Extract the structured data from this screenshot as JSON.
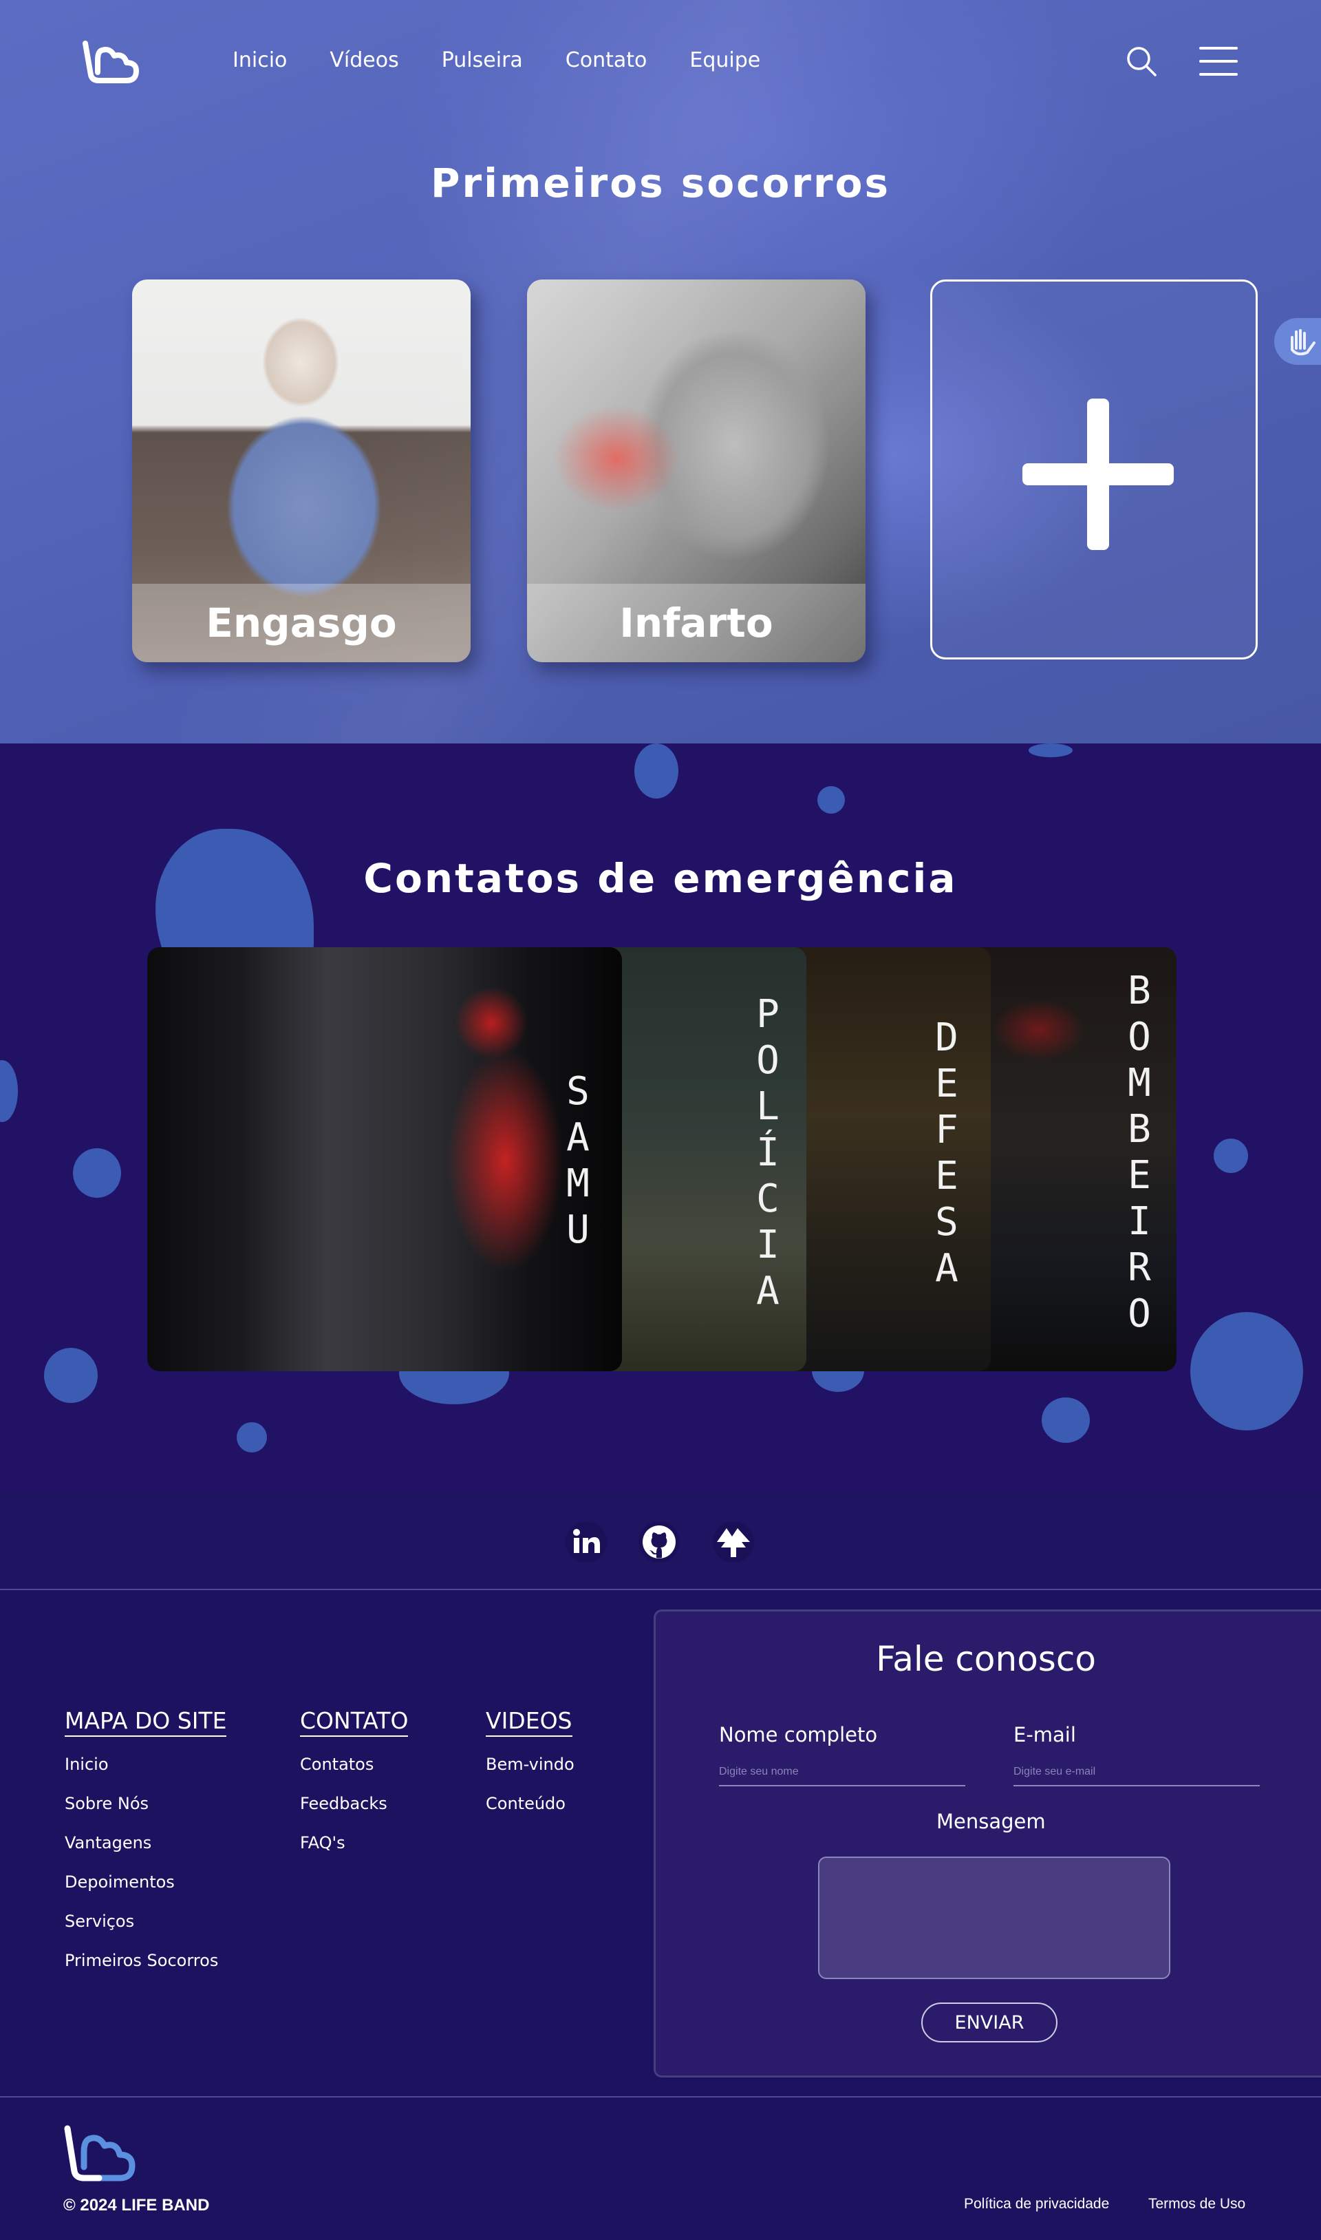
{
  "nav": {
    "items": [
      "Inicio",
      "Vídeos",
      "Pulseira",
      "Contato",
      "Equipe"
    ]
  },
  "first_aid": {
    "title": "Primeiros socorros",
    "cards": [
      "Engasgo",
      "Infarto"
    ]
  },
  "emergency": {
    "title": "Contatos de emergência",
    "panels": {
      "samu": [
        "S",
        "A",
        "M",
        "U"
      ],
      "policia": [
        "P",
        "O",
        "L",
        "Í",
        "C",
        "I",
        "A"
      ],
      "defesa": [
        "D",
        "E",
        "F",
        "E",
        "S",
        "A"
      ],
      "bombeiro": [
        "B",
        "O",
        "M",
        "B",
        "E",
        "I",
        "R",
        "O"
      ]
    }
  },
  "footer": {
    "sitemap": {
      "title": "MAPA DO SITE",
      "items": [
        "Inicio",
        "Sobre Nós",
        "Vantagens",
        "Depoimentos",
        "Serviços",
        "Primeiros Socorros"
      ]
    },
    "contact": {
      "title": "CONTATO",
      "items": [
        "Contatos",
        "Feedbacks",
        "FAQ's"
      ]
    },
    "videos": {
      "title": "VIDEOS",
      "items": [
        "Bem-vindo",
        "Conteúdo"
      ]
    },
    "form": {
      "title": "Fale conosco",
      "name_label": "Nome completo",
      "name_placeholder": "Digite seu nome",
      "email_label": "E-mail",
      "email_placeholder": "Digite seu e-mail",
      "message_label": "Mensagem",
      "submit_label": "ENVIAR"
    },
    "copyright": "© 2024 LIFE BAND",
    "privacy": "Política de privacidade",
    "terms": "Termos de Uso"
  },
  "colors": {
    "hero_bg": "#5566bb",
    "emergency_bg": "#221266",
    "blob": "#3c5bb3",
    "footer_bg": "#1d1260",
    "accent_logo": "#5b8fe0"
  }
}
